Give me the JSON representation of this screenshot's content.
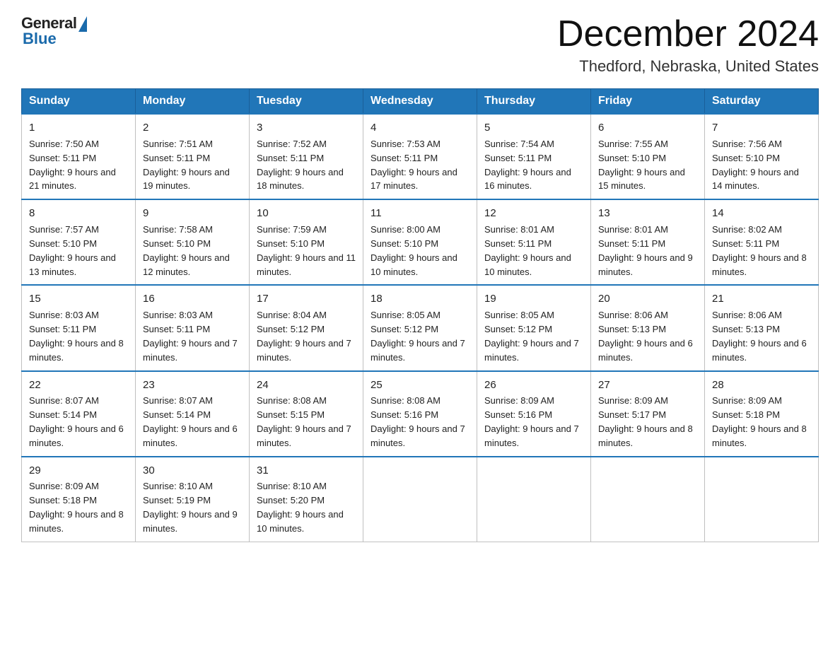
{
  "logo": {
    "general": "General",
    "blue": "Blue"
  },
  "header": {
    "month": "December 2024",
    "location": "Thedford, Nebraska, United States"
  },
  "weekdays": [
    "Sunday",
    "Monday",
    "Tuesday",
    "Wednesday",
    "Thursday",
    "Friday",
    "Saturday"
  ],
  "weeks": [
    [
      {
        "day": "1",
        "sunrise": "7:50 AM",
        "sunset": "5:11 PM",
        "daylight": "9 hours and 21 minutes."
      },
      {
        "day": "2",
        "sunrise": "7:51 AM",
        "sunset": "5:11 PM",
        "daylight": "9 hours and 19 minutes."
      },
      {
        "day": "3",
        "sunrise": "7:52 AM",
        "sunset": "5:11 PM",
        "daylight": "9 hours and 18 minutes."
      },
      {
        "day": "4",
        "sunrise": "7:53 AM",
        "sunset": "5:11 PM",
        "daylight": "9 hours and 17 minutes."
      },
      {
        "day": "5",
        "sunrise": "7:54 AM",
        "sunset": "5:11 PM",
        "daylight": "9 hours and 16 minutes."
      },
      {
        "day": "6",
        "sunrise": "7:55 AM",
        "sunset": "5:10 PM",
        "daylight": "9 hours and 15 minutes."
      },
      {
        "day": "7",
        "sunrise": "7:56 AM",
        "sunset": "5:10 PM",
        "daylight": "9 hours and 14 minutes."
      }
    ],
    [
      {
        "day": "8",
        "sunrise": "7:57 AM",
        "sunset": "5:10 PM",
        "daylight": "9 hours and 13 minutes."
      },
      {
        "day": "9",
        "sunrise": "7:58 AM",
        "sunset": "5:10 PM",
        "daylight": "9 hours and 12 minutes."
      },
      {
        "day": "10",
        "sunrise": "7:59 AM",
        "sunset": "5:10 PM",
        "daylight": "9 hours and 11 minutes."
      },
      {
        "day": "11",
        "sunrise": "8:00 AM",
        "sunset": "5:10 PM",
        "daylight": "9 hours and 10 minutes."
      },
      {
        "day": "12",
        "sunrise": "8:01 AM",
        "sunset": "5:11 PM",
        "daylight": "9 hours and 10 minutes."
      },
      {
        "day": "13",
        "sunrise": "8:01 AM",
        "sunset": "5:11 PM",
        "daylight": "9 hours and 9 minutes."
      },
      {
        "day": "14",
        "sunrise": "8:02 AM",
        "sunset": "5:11 PM",
        "daylight": "9 hours and 8 minutes."
      }
    ],
    [
      {
        "day": "15",
        "sunrise": "8:03 AM",
        "sunset": "5:11 PM",
        "daylight": "9 hours and 8 minutes."
      },
      {
        "day": "16",
        "sunrise": "8:03 AM",
        "sunset": "5:11 PM",
        "daylight": "9 hours and 7 minutes."
      },
      {
        "day": "17",
        "sunrise": "8:04 AM",
        "sunset": "5:12 PM",
        "daylight": "9 hours and 7 minutes."
      },
      {
        "day": "18",
        "sunrise": "8:05 AM",
        "sunset": "5:12 PM",
        "daylight": "9 hours and 7 minutes."
      },
      {
        "day": "19",
        "sunrise": "8:05 AM",
        "sunset": "5:12 PM",
        "daylight": "9 hours and 7 minutes."
      },
      {
        "day": "20",
        "sunrise": "8:06 AM",
        "sunset": "5:13 PM",
        "daylight": "9 hours and 6 minutes."
      },
      {
        "day": "21",
        "sunrise": "8:06 AM",
        "sunset": "5:13 PM",
        "daylight": "9 hours and 6 minutes."
      }
    ],
    [
      {
        "day": "22",
        "sunrise": "8:07 AM",
        "sunset": "5:14 PM",
        "daylight": "9 hours and 6 minutes."
      },
      {
        "day": "23",
        "sunrise": "8:07 AM",
        "sunset": "5:14 PM",
        "daylight": "9 hours and 6 minutes."
      },
      {
        "day": "24",
        "sunrise": "8:08 AM",
        "sunset": "5:15 PM",
        "daylight": "9 hours and 7 minutes."
      },
      {
        "day": "25",
        "sunrise": "8:08 AM",
        "sunset": "5:16 PM",
        "daylight": "9 hours and 7 minutes."
      },
      {
        "day": "26",
        "sunrise": "8:09 AM",
        "sunset": "5:16 PM",
        "daylight": "9 hours and 7 minutes."
      },
      {
        "day": "27",
        "sunrise": "8:09 AM",
        "sunset": "5:17 PM",
        "daylight": "9 hours and 8 minutes."
      },
      {
        "day": "28",
        "sunrise": "8:09 AM",
        "sunset": "5:18 PM",
        "daylight": "9 hours and 8 minutes."
      }
    ],
    [
      {
        "day": "29",
        "sunrise": "8:09 AM",
        "sunset": "5:18 PM",
        "daylight": "9 hours and 8 minutes."
      },
      {
        "day": "30",
        "sunrise": "8:10 AM",
        "sunset": "5:19 PM",
        "daylight": "9 hours and 9 minutes."
      },
      {
        "day": "31",
        "sunrise": "8:10 AM",
        "sunset": "5:20 PM",
        "daylight": "9 hours and 10 minutes."
      },
      null,
      null,
      null,
      null
    ]
  ]
}
